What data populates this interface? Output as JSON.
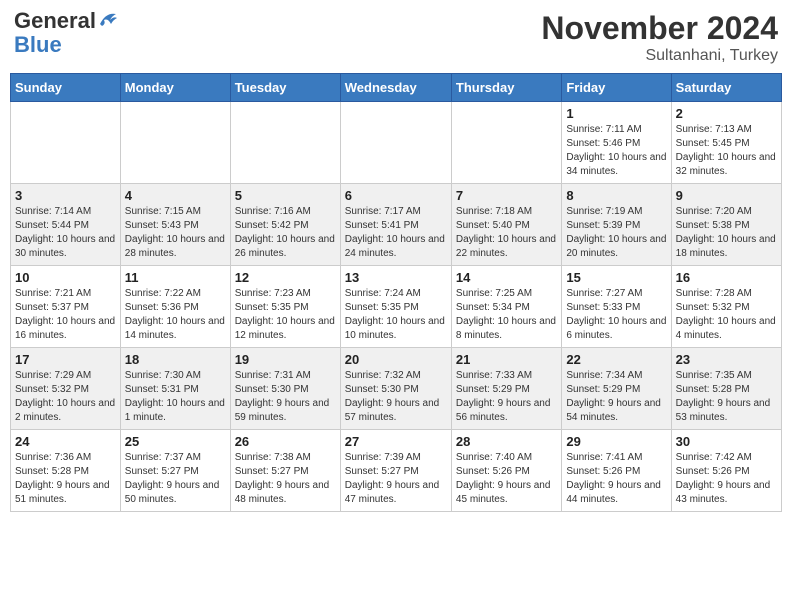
{
  "header": {
    "logo_general": "General",
    "logo_blue": "Blue",
    "month_title": "November 2024",
    "location": "Sultanhani, Turkey"
  },
  "weekdays": [
    "Sunday",
    "Monday",
    "Tuesday",
    "Wednesday",
    "Thursday",
    "Friday",
    "Saturday"
  ],
  "weeks": [
    [
      {
        "day": "",
        "sunrise": "",
        "sunset": "",
        "daylight": ""
      },
      {
        "day": "",
        "sunrise": "",
        "sunset": "",
        "daylight": ""
      },
      {
        "day": "",
        "sunrise": "",
        "sunset": "",
        "daylight": ""
      },
      {
        "day": "",
        "sunrise": "",
        "sunset": "",
        "daylight": ""
      },
      {
        "day": "",
        "sunrise": "",
        "sunset": "",
        "daylight": ""
      },
      {
        "day": "1",
        "sunrise": "Sunrise: 7:11 AM",
        "sunset": "Sunset: 5:46 PM",
        "daylight": "Daylight: 10 hours and 34 minutes."
      },
      {
        "day": "2",
        "sunrise": "Sunrise: 7:13 AM",
        "sunset": "Sunset: 5:45 PM",
        "daylight": "Daylight: 10 hours and 32 minutes."
      }
    ],
    [
      {
        "day": "3",
        "sunrise": "Sunrise: 7:14 AM",
        "sunset": "Sunset: 5:44 PM",
        "daylight": "Daylight: 10 hours and 30 minutes."
      },
      {
        "day": "4",
        "sunrise": "Sunrise: 7:15 AM",
        "sunset": "Sunset: 5:43 PM",
        "daylight": "Daylight: 10 hours and 28 minutes."
      },
      {
        "day": "5",
        "sunrise": "Sunrise: 7:16 AM",
        "sunset": "Sunset: 5:42 PM",
        "daylight": "Daylight: 10 hours and 26 minutes."
      },
      {
        "day": "6",
        "sunrise": "Sunrise: 7:17 AM",
        "sunset": "Sunset: 5:41 PM",
        "daylight": "Daylight: 10 hours and 24 minutes."
      },
      {
        "day": "7",
        "sunrise": "Sunrise: 7:18 AM",
        "sunset": "Sunset: 5:40 PM",
        "daylight": "Daylight: 10 hours and 22 minutes."
      },
      {
        "day": "8",
        "sunrise": "Sunrise: 7:19 AM",
        "sunset": "Sunset: 5:39 PM",
        "daylight": "Daylight: 10 hours and 20 minutes."
      },
      {
        "day": "9",
        "sunrise": "Sunrise: 7:20 AM",
        "sunset": "Sunset: 5:38 PM",
        "daylight": "Daylight: 10 hours and 18 minutes."
      }
    ],
    [
      {
        "day": "10",
        "sunrise": "Sunrise: 7:21 AM",
        "sunset": "Sunset: 5:37 PM",
        "daylight": "Daylight: 10 hours and 16 minutes."
      },
      {
        "day": "11",
        "sunrise": "Sunrise: 7:22 AM",
        "sunset": "Sunset: 5:36 PM",
        "daylight": "Daylight: 10 hours and 14 minutes."
      },
      {
        "day": "12",
        "sunrise": "Sunrise: 7:23 AM",
        "sunset": "Sunset: 5:35 PM",
        "daylight": "Daylight: 10 hours and 12 minutes."
      },
      {
        "day": "13",
        "sunrise": "Sunrise: 7:24 AM",
        "sunset": "Sunset: 5:35 PM",
        "daylight": "Daylight: 10 hours and 10 minutes."
      },
      {
        "day": "14",
        "sunrise": "Sunrise: 7:25 AM",
        "sunset": "Sunset: 5:34 PM",
        "daylight": "Daylight: 10 hours and 8 minutes."
      },
      {
        "day": "15",
        "sunrise": "Sunrise: 7:27 AM",
        "sunset": "Sunset: 5:33 PM",
        "daylight": "Daylight: 10 hours and 6 minutes."
      },
      {
        "day": "16",
        "sunrise": "Sunrise: 7:28 AM",
        "sunset": "Sunset: 5:32 PM",
        "daylight": "Daylight: 10 hours and 4 minutes."
      }
    ],
    [
      {
        "day": "17",
        "sunrise": "Sunrise: 7:29 AM",
        "sunset": "Sunset: 5:32 PM",
        "daylight": "Daylight: 10 hours and 2 minutes."
      },
      {
        "day": "18",
        "sunrise": "Sunrise: 7:30 AM",
        "sunset": "Sunset: 5:31 PM",
        "daylight": "Daylight: 10 hours and 1 minute."
      },
      {
        "day": "19",
        "sunrise": "Sunrise: 7:31 AM",
        "sunset": "Sunset: 5:30 PM",
        "daylight": "Daylight: 9 hours and 59 minutes."
      },
      {
        "day": "20",
        "sunrise": "Sunrise: 7:32 AM",
        "sunset": "Sunset: 5:30 PM",
        "daylight": "Daylight: 9 hours and 57 minutes."
      },
      {
        "day": "21",
        "sunrise": "Sunrise: 7:33 AM",
        "sunset": "Sunset: 5:29 PM",
        "daylight": "Daylight: 9 hours and 56 minutes."
      },
      {
        "day": "22",
        "sunrise": "Sunrise: 7:34 AM",
        "sunset": "Sunset: 5:29 PM",
        "daylight": "Daylight: 9 hours and 54 minutes."
      },
      {
        "day": "23",
        "sunrise": "Sunrise: 7:35 AM",
        "sunset": "Sunset: 5:28 PM",
        "daylight": "Daylight: 9 hours and 53 minutes."
      }
    ],
    [
      {
        "day": "24",
        "sunrise": "Sunrise: 7:36 AM",
        "sunset": "Sunset: 5:28 PM",
        "daylight": "Daylight: 9 hours and 51 minutes."
      },
      {
        "day": "25",
        "sunrise": "Sunrise: 7:37 AM",
        "sunset": "Sunset: 5:27 PM",
        "daylight": "Daylight: 9 hours and 50 minutes."
      },
      {
        "day": "26",
        "sunrise": "Sunrise: 7:38 AM",
        "sunset": "Sunset: 5:27 PM",
        "daylight": "Daylight: 9 hours and 48 minutes."
      },
      {
        "day": "27",
        "sunrise": "Sunrise: 7:39 AM",
        "sunset": "Sunset: 5:27 PM",
        "daylight": "Daylight: 9 hours and 47 minutes."
      },
      {
        "day": "28",
        "sunrise": "Sunrise: 7:40 AM",
        "sunset": "Sunset: 5:26 PM",
        "daylight": "Daylight: 9 hours and 45 minutes."
      },
      {
        "day": "29",
        "sunrise": "Sunrise: 7:41 AM",
        "sunset": "Sunset: 5:26 PM",
        "daylight": "Daylight: 9 hours and 44 minutes."
      },
      {
        "day": "30",
        "sunrise": "Sunrise: 7:42 AM",
        "sunset": "Sunset: 5:26 PM",
        "daylight": "Daylight: 9 hours and 43 minutes."
      }
    ]
  ]
}
